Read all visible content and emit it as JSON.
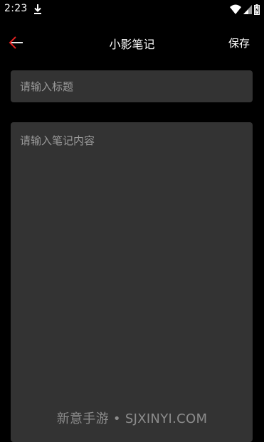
{
  "status_bar": {
    "time": "2:23",
    "icons": [
      "download-icon",
      "wifi-icon",
      "signal-icon",
      "battery-icon"
    ]
  },
  "app_bar": {
    "title": "小影笔记",
    "save_label": "保存",
    "back_icon": "arrow-left-icon",
    "back_icon_color": "#e02020"
  },
  "form": {
    "title_placeholder": "请输入标题",
    "title_value": "",
    "content_placeholder": "请输入笔记内容",
    "content_value": ""
  },
  "watermark": {
    "text": "新意手游 • SJXINYI.COM"
  },
  "colors": {
    "background": "#000000",
    "field_background": "#333333",
    "placeholder": "#9a9a9a",
    "accent": "#e02020"
  }
}
